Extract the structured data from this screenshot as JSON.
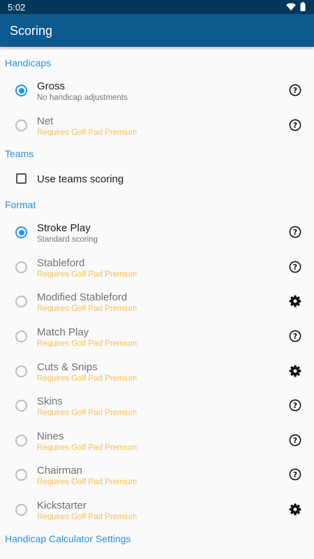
{
  "status_bar": {
    "time": "5:02",
    "icons": [
      "wifi-icon",
      "battery-icon"
    ]
  },
  "app_bar": {
    "title": "Scoring"
  },
  "colors": {
    "app_bar": "#0c5a8e",
    "status_bar": "#02385c",
    "accent": "#2196f3",
    "section": "#2a8fd6",
    "premium": "#f2c14f"
  },
  "handicaps": {
    "header": "Handicaps",
    "options": [
      {
        "title": "Gross",
        "subtitle": "No handicap adjustments",
        "selected": true,
        "icon": "help-icon"
      },
      {
        "title": "Net",
        "subtitle": "Requires Golf Pad Premium",
        "selected": false,
        "icon": "help-icon"
      }
    ]
  },
  "teams": {
    "header": "Teams",
    "checkbox_label": "Use teams scoring",
    "checked": false
  },
  "format": {
    "header": "Format",
    "options": [
      {
        "title": "Stroke Play",
        "subtitle": "Standard scoring",
        "selected": true,
        "icon": "help-icon"
      },
      {
        "title": "Stableford",
        "subtitle": "Requires Golf Pad Premium",
        "selected": false,
        "icon": "help-icon"
      },
      {
        "title": "Modified Stableford",
        "subtitle": "Requires Golf Pad Premium",
        "selected": false,
        "icon": "gear-icon"
      },
      {
        "title": "Match Play",
        "subtitle": "Requires Golf Pad Premium",
        "selected": false,
        "icon": "help-icon"
      },
      {
        "title": "Cuts & Snips",
        "subtitle": "Requires Golf Pad Premium",
        "selected": false,
        "icon": "gear-icon"
      },
      {
        "title": "Skins",
        "subtitle": "Requires Golf Pad Premium",
        "selected": false,
        "icon": "help-icon"
      },
      {
        "title": "Nines",
        "subtitle": "Requires Golf Pad Premium",
        "selected": false,
        "icon": "help-icon"
      },
      {
        "title": "Chairman",
        "subtitle": "Requires Golf Pad Premium",
        "selected": false,
        "icon": "help-icon"
      },
      {
        "title": "Kickstarter",
        "subtitle": "Requires Golf Pad Premium",
        "selected": false,
        "icon": "gear-icon"
      }
    ]
  },
  "handicap_calculator": {
    "header": "Handicap Calculator Settings"
  }
}
